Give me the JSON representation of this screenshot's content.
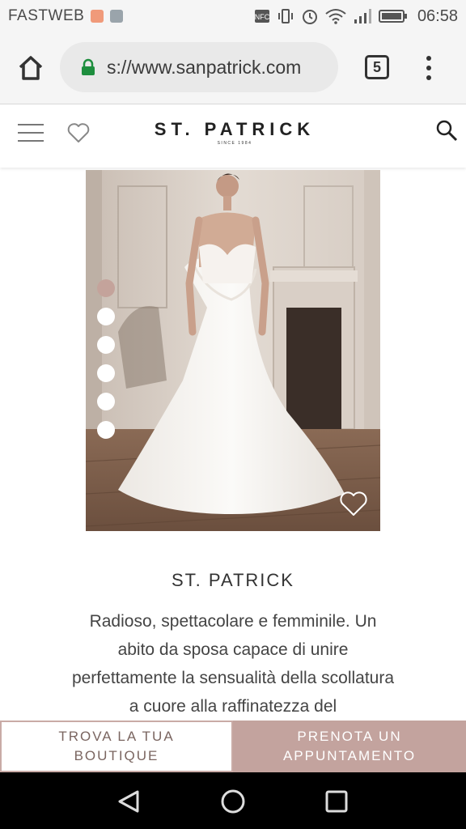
{
  "status_bar": {
    "carrier": "FASTWEB",
    "time": "06:58",
    "icons": [
      "notification-app-icon",
      "image-icon",
      "nfc-icon",
      "vibrate-icon",
      "alarm-icon",
      "wifi-icon",
      "signal-icon",
      "battery-icon"
    ]
  },
  "browser": {
    "url": "s://www.sanpatrick.com",
    "tab_count": "5",
    "icons": [
      "home-icon",
      "lock-icon",
      "more-vert-icon"
    ],
    "lock_color": "#1e8e3e"
  },
  "site_header": {
    "logo": "ST. PATRICK",
    "logo_tagline": "SINCE 1984",
    "icons": [
      "hamburger-icon",
      "heart-icon",
      "search-icon"
    ]
  },
  "carousel": {
    "slide_count": 6,
    "active_index": 0,
    "accent_color": "#c4a39b"
  },
  "product": {
    "brand": "ST. PATRICK",
    "description": "Radioso, spettacolare e femminile. Un abito da sposa capace di unire perfettamente la sensualità della scollatura a cuore alla raffinatezza del"
  },
  "cta": {
    "find_boutique": "TROVA LA TUA BOUTIQUE",
    "book_appointment": "PRENOTA UN APPUNTAMENTO",
    "accent_color": "#c3a39e"
  },
  "nav_bar": {
    "icons": [
      "back-icon",
      "home-circle-icon",
      "recents-icon"
    ]
  }
}
